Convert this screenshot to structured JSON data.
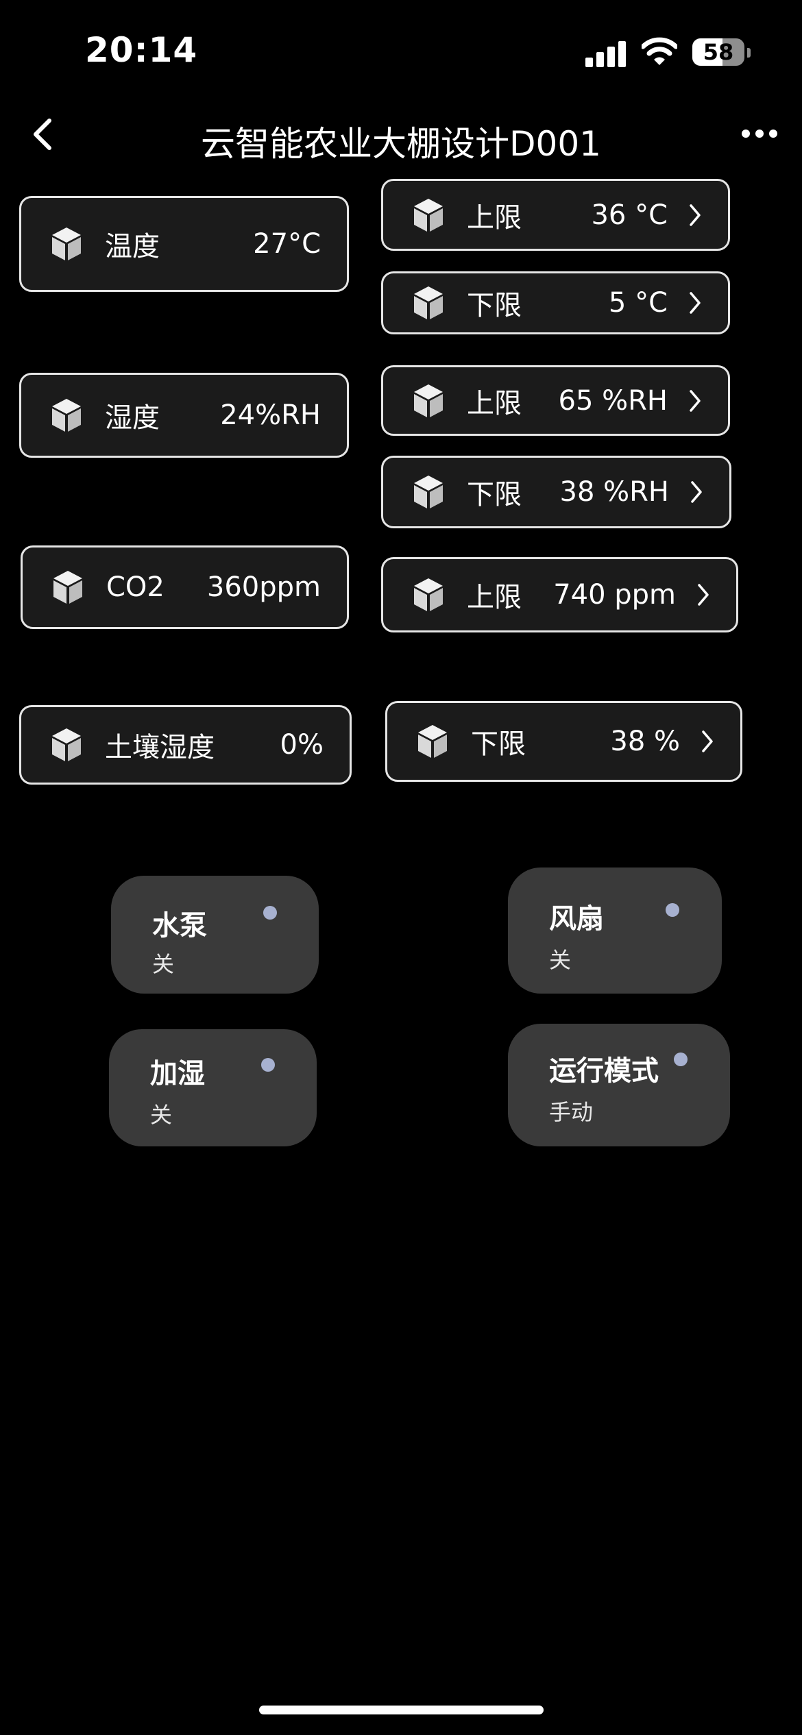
{
  "status_bar": {
    "time": "20:14",
    "battery": "58",
    "battery_level": 0.58
  },
  "header": {
    "title": "云智能农业大棚设计D001",
    "back_icon": "chevron-left-icon",
    "more_icon": "more-dots-icon"
  },
  "sensors": [
    {
      "label": "温度",
      "value": "27°C"
    },
    {
      "label": "湿度",
      "value": "24%RH"
    },
    {
      "label": "CO2",
      "value": "360ppm"
    },
    {
      "label": "土壤湿度",
      "value": "0%"
    }
  ],
  "limits": [
    {
      "label": "上限",
      "value": "36 °C"
    },
    {
      "label": "下限",
      "value": "5 °C"
    },
    {
      "label": "上限",
      "value": "65 %RH"
    },
    {
      "label": "下限",
      "value": "38 %RH"
    },
    {
      "label": "上限",
      "value": "740 ppm"
    },
    {
      "label": "下限",
      "value": "38 %"
    }
  ],
  "controls": [
    {
      "name": "水泵",
      "state": "关"
    },
    {
      "name": "风扇",
      "state": "关"
    },
    {
      "name": "加湿",
      "state": "关"
    },
    {
      "name": "运行模式",
      "state": "手动"
    }
  ],
  "colors": {
    "background": "#000000",
    "card": "#1b1b1b",
    "card_border": "#e6e6e6",
    "control": "#3a3a3a",
    "indicator_dot": "#a7b1d0"
  }
}
